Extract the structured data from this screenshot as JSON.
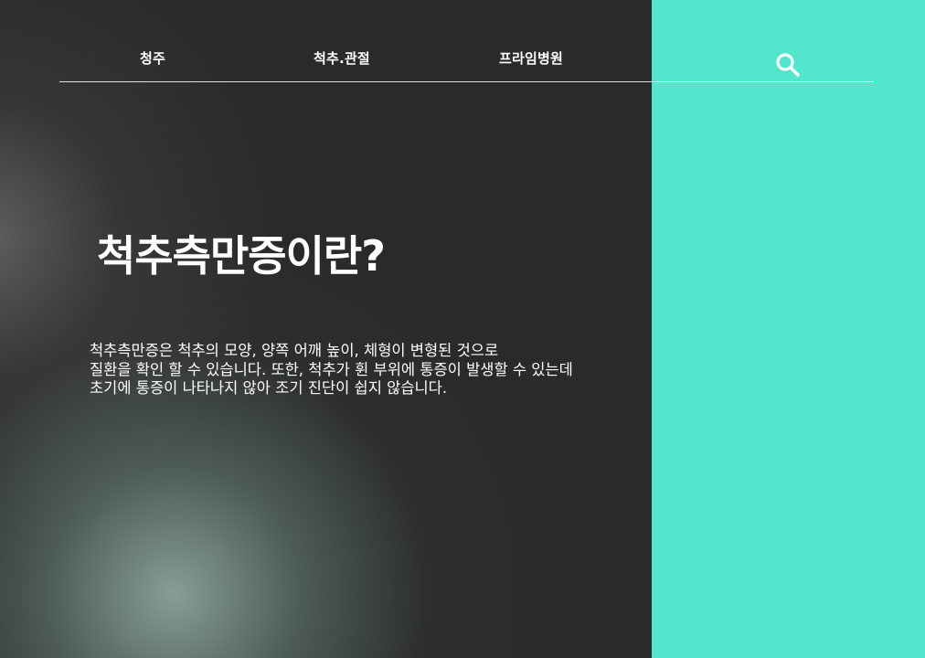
{
  "nav": {
    "items": [
      {
        "label": "청주"
      },
      {
        "label": "척추.관절"
      },
      {
        "label": "프라임병원"
      }
    ],
    "search_icon": "search-icon"
  },
  "hero": {
    "title": "척추측만증이란?",
    "description_lines": [
      "척추측만증은 척추의 모양, 양쪽 어깨 높이, 체형이 변형된 것으로",
      "질환을 확인 할 수 있습니다. 또한, 척추가 휜 부위에 통증이 발생할 수 있는데",
      "초기에 통증이 나타나지 않아 조기 진단이 쉽지 않습니다."
    ]
  },
  "colors": {
    "background_dark": "#2a2a2a",
    "accent_panel": "#52e6cd",
    "text": "#ffffff"
  }
}
